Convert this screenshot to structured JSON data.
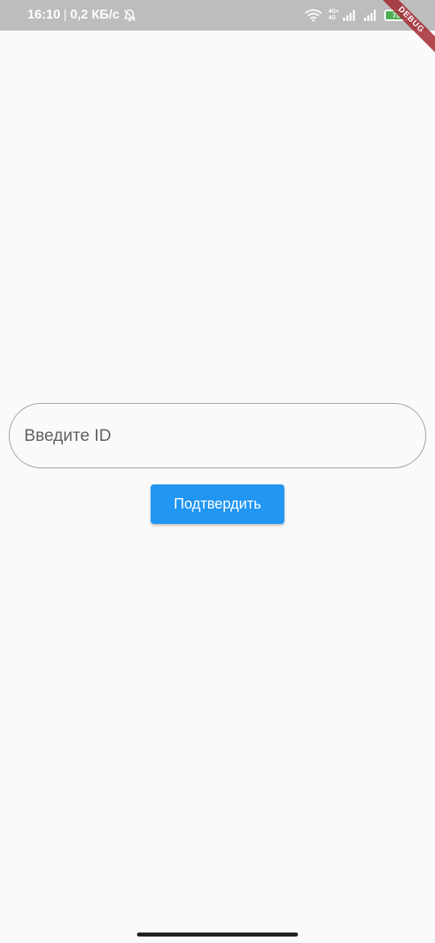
{
  "status_bar": {
    "time": "16:10",
    "separator": "|",
    "net_speed": "0,2 КБ/с",
    "network_top": "4G+",
    "network_bottom": "4G",
    "battery_percent": "78",
    "battery_level": 0.78,
    "battery_color": "#4caf50",
    "background_color": "#bdbdbd"
  },
  "debug_banner": {
    "label": "DEBUG"
  },
  "form": {
    "id_input": {
      "placeholder": "Введите ID",
      "value": ""
    },
    "submit_label": "Подтвердить",
    "accent_color": "#2196f3"
  }
}
